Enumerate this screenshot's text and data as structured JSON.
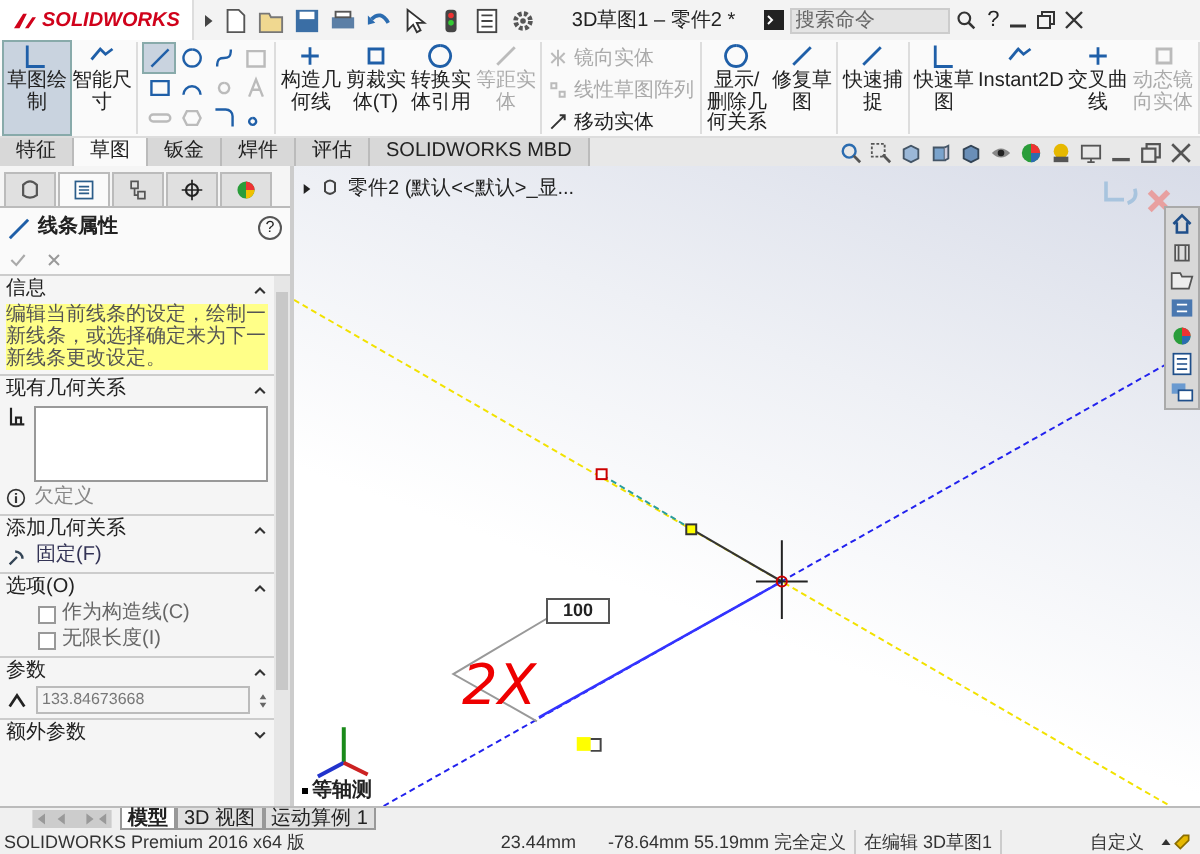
{
  "title_bar": {
    "logo": "SOLIDWORKS",
    "document_title": "3D草图1 – 零件2 *",
    "search": {
      "placeholder": "搜索命令"
    },
    "help": "?"
  },
  "ribbon": [
    {
      "kind": "buttons",
      "items": [
        {
          "label": "草图绘制",
          "selected": true,
          "disabled": false
        },
        {
          "label": "智能尺寸",
          "selected": false,
          "disabled": false
        }
      ]
    },
    {
      "kind": "grid",
      "items": [
        {
          "selected": true,
          "disabled": false
        },
        {
          "selected": false,
          "disabled": false
        },
        {
          "selected": false,
          "disabled": false
        },
        {
          "selected": false,
          "disabled": true
        },
        {
          "selected": false,
          "disabled": false
        },
        {
          "selected": false,
          "disabled": false
        },
        {
          "selected": false,
          "disabled": true
        },
        {
          "selected": false,
          "disabled": true
        },
        {
          "selected": false,
          "disabled": true
        },
        {
          "selected": false,
          "disabled": true
        },
        {
          "selected": false,
          "disabled": false
        },
        {
          "selected": false,
          "disabled": false
        }
      ]
    },
    {
      "kind": "buttons",
      "items": [
        {
          "label": "构造几何线",
          "selected": false,
          "disabled": false
        },
        {
          "label": "剪裁实体(T)",
          "selected": false,
          "disabled": false
        },
        {
          "label": "转换实体引用",
          "selected": false,
          "disabled": false
        },
        {
          "label": "等距实体",
          "selected": false,
          "disabled": true
        }
      ]
    },
    {
      "kind": "list",
      "items": [
        {
          "label": "镜向实体",
          "disabled": true
        },
        {
          "label": "线性草图阵列",
          "disabled": true
        },
        {
          "label": "移动实体",
          "disabled": false
        }
      ]
    },
    {
      "kind": "buttons",
      "items": [
        {
          "label": "显示/删除几何关系",
          "selected": false,
          "disabled": false
        },
        {
          "label": "修复草图",
          "selected": false,
          "disabled": false
        }
      ]
    },
    {
      "kind": "buttons",
      "items": [
        {
          "label": "快速捕捉",
          "selected": false,
          "disabled": false
        }
      ]
    },
    {
      "kind": "buttons",
      "items": [
        {
          "label": "快速草图",
          "selected": false,
          "disabled": false
        },
        {
          "label": "Instant2D",
          "selected": false,
          "disabled": false
        },
        {
          "label": "交叉曲线",
          "selected": false,
          "disabled": false
        },
        {
          "label": "动态镜向实体",
          "selected": false,
          "disabled": true
        }
      ]
    }
  ],
  "command_tabs": [
    {
      "label": "特征",
      "selected": false
    },
    {
      "label": "草图",
      "selected": true
    },
    {
      "label": "钣金",
      "selected": false
    },
    {
      "label": "焊件",
      "selected": false
    },
    {
      "label": "评估",
      "selected": false
    },
    {
      "label": "SOLIDWORKS MBD",
      "selected": false
    }
  ],
  "property_manager": {
    "panel_tabs": [
      {
        "selected": false
      },
      {
        "selected": true
      },
      {
        "selected": false
      },
      {
        "selected": false
      },
      {
        "selected": false
      }
    ],
    "title": "线条属性",
    "help": "?",
    "sections": [
      {
        "kind": "message",
        "title": "信息",
        "expanded": true,
        "text": "编辑当前线条的设定，绘制一新线条，或选择确定来为下一新线条更改设定。"
      },
      {
        "kind": "relations",
        "title": "现有几何关系",
        "expanded": true,
        "status": "欠定义"
      },
      {
        "kind": "add_relations",
        "title": "添加几何关系",
        "expanded": true,
        "items": [
          "固定(F)"
        ]
      },
      {
        "kind": "options",
        "title": "选项(O)",
        "expanded": true,
        "options": [
          {
            "label": "作为构造线(C)",
            "checked": false
          },
          {
            "label": "无限长度(I)",
            "checked": false
          }
        ]
      },
      {
        "kind": "parameters",
        "title": "参数",
        "expanded": true,
        "value": "133.84673668"
      },
      {
        "kind": "extra",
        "title": "额外参数",
        "expanded": false
      }
    ]
  },
  "viewport": {
    "tree_item": "零件2 (默认<<默认>_显...",
    "dimension": "100",
    "annotation": "2X",
    "view_label": "等轴测"
  },
  "bottom_tabs": [
    {
      "label": "模型",
      "selected": true
    },
    {
      "label": "3D 视图",
      "selected": false
    },
    {
      "label": "运动算例 1",
      "selected": false
    }
  ],
  "status_bar": [
    "SOLIDWORKS Premium 2016 x64 版",
    "23.44mm",
    "-78.64mm 55.19mm 完全定义",
    "在编辑 3D草图1",
    "自定义"
  ]
}
